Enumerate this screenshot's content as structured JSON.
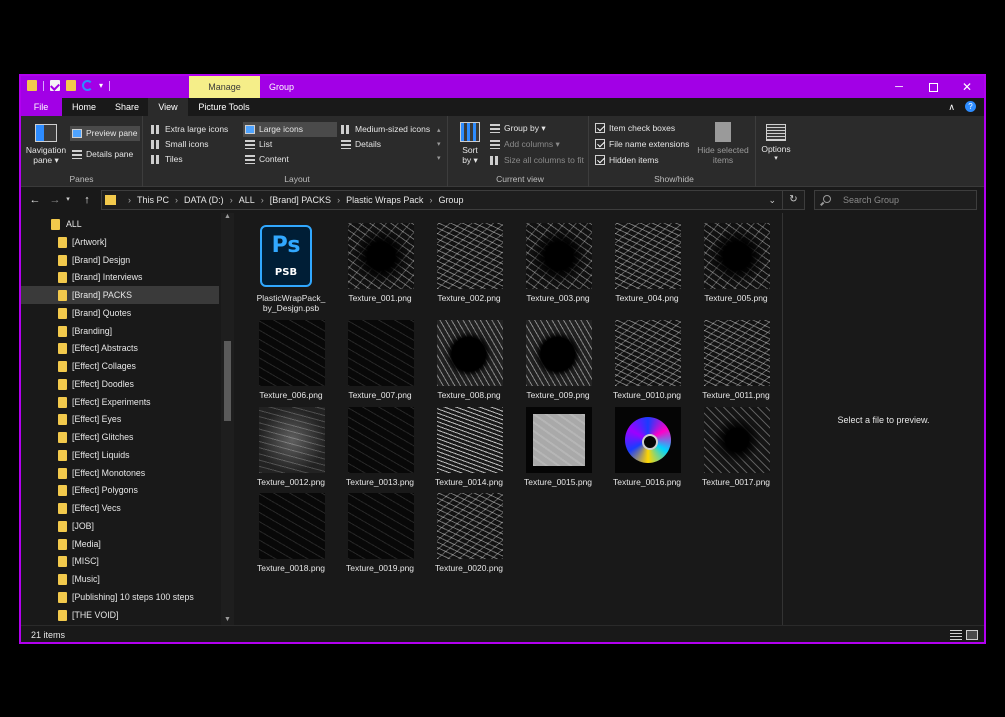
{
  "titlebar": {
    "context_tab": "Manage",
    "title": "Group",
    "minimize": "─",
    "close": "✕"
  },
  "tabs": {
    "file": "File",
    "home": "Home",
    "share": "Share",
    "view": "View",
    "picture_tools": "Picture Tools",
    "collapse": "∧"
  },
  "ribbon": {
    "panes": {
      "label": "Panes",
      "navigation_pane": "Navigation",
      "navigation_pane_2": "pane",
      "preview_pane": "Preview pane",
      "details_pane": "Details pane"
    },
    "layout": {
      "label": "Layout",
      "extra_large_icons": "Extra large icons",
      "large_icons": "Large icons",
      "medium_sized_icons": "Medium-sized icons",
      "small_icons": "Small icons",
      "list": "List",
      "details": "Details",
      "tiles": "Tiles",
      "content": "Content"
    },
    "current_view": {
      "label": "Current view",
      "sort_by": "Sort",
      "sort_by_2": "by",
      "group_by": "Group by",
      "add_columns": "Add columns",
      "size_all_columns": "Size all columns to fit"
    },
    "show_hide": {
      "label": "Show/hide",
      "item_check_boxes": "Item check boxes",
      "file_name_extensions": "File name extensions",
      "hidden_items": "Hidden items",
      "hide_selected_items": "Hide selected",
      "hide_selected_items_2": "items",
      "item_check_boxes_checked": true,
      "file_name_extensions_checked": true,
      "hidden_items_checked": true
    },
    "options": "Options"
  },
  "address": {
    "breadcrumbs": [
      "This PC",
      "DATA (D:)",
      "ALL",
      "[Brand] PACKS",
      "Plastic Wraps Pack",
      "Group"
    ],
    "search_placeholder": "Search Group"
  },
  "nav": {
    "items": [
      {
        "label": "ALL",
        "selected": false,
        "indent": 1
      },
      {
        "label": "[Artwork]",
        "selected": false,
        "indent": 2
      },
      {
        "label": "[Brand] Desjgn",
        "selected": false,
        "indent": 2
      },
      {
        "label": "[Brand] Interviews",
        "selected": false,
        "indent": 2
      },
      {
        "label": "[Brand] PACKS",
        "selected": true,
        "indent": 2
      },
      {
        "label": "[Brand] Quotes",
        "selected": false,
        "indent": 2
      },
      {
        "label": "[Branding]",
        "selected": false,
        "indent": 2
      },
      {
        "label": "[Effect] Abstracts",
        "selected": false,
        "indent": 2
      },
      {
        "label": "[Effect] Collages",
        "selected": false,
        "indent": 2
      },
      {
        "label": "[Effect] Doodles",
        "selected": false,
        "indent": 2
      },
      {
        "label": "[Effect] Experiments",
        "selected": false,
        "indent": 2
      },
      {
        "label": "[Effect] Eyes",
        "selected": false,
        "indent": 2
      },
      {
        "label": "[Effect] Glitches",
        "selected": false,
        "indent": 2
      },
      {
        "label": "[Effect] Liquids",
        "selected": false,
        "indent": 2
      },
      {
        "label": "[Effect] Monotones",
        "selected": false,
        "indent": 2
      },
      {
        "label": "[Effect] Polygons",
        "selected": false,
        "indent": 2
      },
      {
        "label": "[Effect] Vecs",
        "selected": false,
        "indent": 2
      },
      {
        "label": "[JOB]",
        "selected": false,
        "indent": 2
      },
      {
        "label": "[Media]",
        "selected": false,
        "indent": 2
      },
      {
        "label": "[MISC]",
        "selected": false,
        "indent": 2
      },
      {
        "label": "[Music]",
        "selected": false,
        "indent": 2
      },
      {
        "label": "[Publishing] 10 steps 100 steps",
        "selected": false,
        "indent": 2
      },
      {
        "label": "[THE VOID]",
        "selected": false,
        "indent": 2
      }
    ]
  },
  "files": [
    {
      "name": "PlasticWrapPack_by_Desjgn.psb",
      "line1": "PlasticWrapPack_",
      "line2": "by_Desjgn.psb",
      "kind": "psb",
      "icon_text": "Ps",
      "icon_sub": "PSB"
    },
    {
      "name": "Texture_001.png",
      "kind": "t-border"
    },
    {
      "name": "Texture_002.png",
      "kind": "t-full"
    },
    {
      "name": "Texture_003.png",
      "kind": "t-border"
    },
    {
      "name": "Texture_004.png",
      "kind": "t-full"
    },
    {
      "name": "Texture_005.png",
      "kind": "t-border"
    },
    {
      "name": "Texture_006.png",
      "kind": "t-dark"
    },
    {
      "name": "Texture_007.png",
      "kind": "t-dark"
    },
    {
      "name": "Texture_008.png",
      "kind": "t-hole"
    },
    {
      "name": "Texture_009.png",
      "kind": "t-hole"
    },
    {
      "name": "Texture_0010.png",
      "kind": "t-full"
    },
    {
      "name": "Texture_0011.png",
      "kind": "t-full"
    },
    {
      "name": "Texture_0012.png",
      "kind": "t-wrap"
    },
    {
      "name": "Texture_0013.png",
      "kind": "t-dark"
    },
    {
      "name": "Texture_0014.png",
      "kind": "t-waves"
    },
    {
      "name": "Texture_0015.png",
      "kind": "t-grey"
    },
    {
      "name": "Texture_0016.png",
      "kind": "disc"
    },
    {
      "name": "Texture_0017.png",
      "kind": "t-frame"
    },
    {
      "name": "Texture_0018.png",
      "kind": "t-dark"
    },
    {
      "name": "Texture_0019.png",
      "kind": "t-dark"
    },
    {
      "name": "Texture_0020.png",
      "kind": "t-full"
    }
  ],
  "preview": {
    "message": "Select a file to preview."
  },
  "status": {
    "item_count": "21 items"
  },
  "colors": {
    "accent": "#a200e6",
    "context_tab": "#f5ee89",
    "background": "#191919"
  }
}
